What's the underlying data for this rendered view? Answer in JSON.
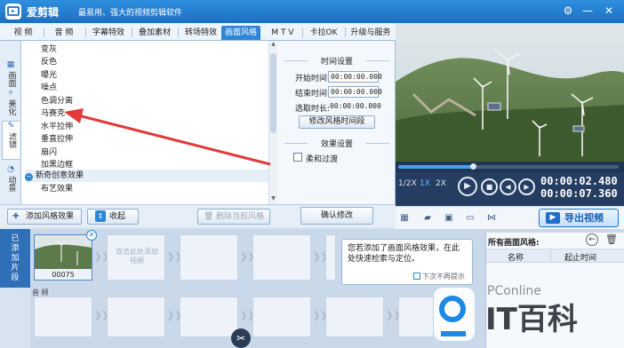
{
  "app": {
    "name": "爱剪辑",
    "slogan": "最易用、强大的视频剪辑软件"
  },
  "tabs": [
    "视  频",
    "音  频",
    "字幕特效",
    "叠加素材",
    "转场特效",
    "画面风格",
    "M T V",
    "卡拉OK",
    "升级与服务"
  ],
  "active_tab": "画面风格",
  "side_tabs": [
    {
      "label": "画面",
      "icon": "picture-icon"
    },
    {
      "label": "美化",
      "icon": "wand-icon"
    },
    {
      "label": "滤镜",
      "icon": "brush-icon"
    },
    {
      "label": "动景",
      "icon": "motion-icon"
    }
  ],
  "effects": [
    "变灰",
    "反色",
    "曝光",
    "噪点",
    "色调分离",
    "马赛克",
    "水平拉伸",
    "垂直拉伸",
    "扇闪",
    "加黑边框"
  ],
  "effect_category": "新奇创意效果",
  "effects_after": [
    "布艺效果"
  ],
  "time_settings": {
    "title": "时间设置",
    "start_label": "开始时间:",
    "start_value": "00:00:00.000",
    "end_label": "结束时间:",
    "end_value": "00:00:00.000",
    "duration_label": "选取时长:",
    "duration_value": "00:00:00.000",
    "modify_button": "修改风格时间段"
  },
  "effect_settings": {
    "title": "效果设置",
    "fade_label": "柔和过渡"
  },
  "effect_toolbar": {
    "add_button": "添加风格效果",
    "collapse_button": "收起",
    "delete_button": "删除当前风格",
    "confirm_button": "确认修改"
  },
  "player": {
    "speeds": [
      "1/2X",
      "1X",
      "2X"
    ],
    "active_speed": "1X",
    "current_time": "00:00:02.480",
    "total_time": "00:00:07.360",
    "progress": 0.34,
    "export_button": "导出视频"
  },
  "timeline": {
    "side_label": "已添加片段",
    "clip_name": "00075",
    "placeholder": "双击此处添加视频",
    "audio_label": "音  频"
  },
  "tooltip": {
    "text": "您若添加了画面风格效果，在此处快速检索与定位。",
    "checkbox": "下次不再提示"
  },
  "right_panel": {
    "title": "所有画面风格:",
    "col_name": "名称",
    "col_time": "起止时间"
  },
  "watermark": {
    "site": "PConline",
    "brand": "IT百科"
  },
  "colors": {
    "title_bar": "#1c6fc4",
    "active_tab": "#2f86d8",
    "annotation_arrow": "#e23a3a"
  }
}
